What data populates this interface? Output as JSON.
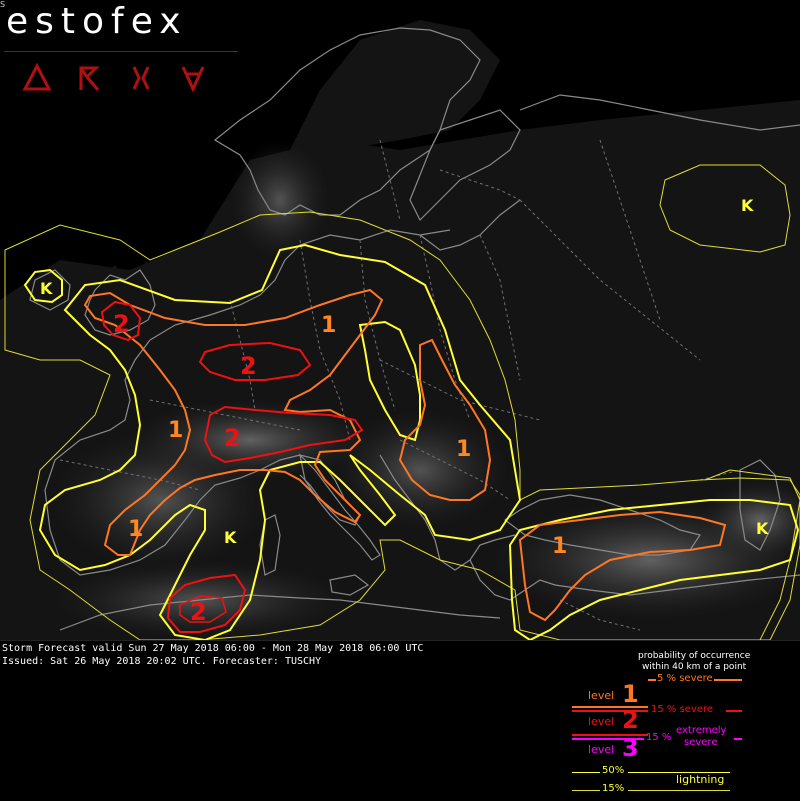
{
  "header": {
    "logo_text": "estofex",
    "corner_mark": "S",
    "symbols": [
      {
        "name": "tornado-symbol",
        "color": "#b01010"
      },
      {
        "name": "large-hail-symbol",
        "color": "#b01010"
      },
      {
        "name": "severe-wind-symbol",
        "color": "#b01010"
      },
      {
        "name": "excessive-rain-symbol",
        "color": "#b01010"
      }
    ]
  },
  "map": {
    "colors": {
      "lightning": "#ffff33",
      "lightning_15": "#dddd33",
      "level1": "#ff7722",
      "level2": "#ee1111",
      "level3": "#ff00ff",
      "coast": "#888888",
      "border": "#777777"
    },
    "labels": {
      "level1": "1",
      "level2": "2",
      "hail": "K"
    }
  },
  "forecast": {
    "valid_line": "Storm Forecast valid Sun 27 May 2018 06:00 - Mon 28 May 2018 06:00 UTC",
    "issued_line": "Issued: Sat 26 May 2018 20:02 UTC. Forecaster: TUSCHY"
  },
  "legend": {
    "header_line1": "probability of occurrence",
    "header_line2": "within 40 km of a point",
    "level_word": "level",
    "level1_number": "1",
    "level2_number": "2",
    "level3_number": "3",
    "level1_pct": "5 % severe",
    "level2_pct": "15 % severe",
    "level3_pct": "15 %",
    "level3_desc_line1": "extremely",
    "level3_desc_line2": "severe",
    "lightning_50": "50%",
    "lightning_15": "15%",
    "lightning_word": "lightning"
  }
}
